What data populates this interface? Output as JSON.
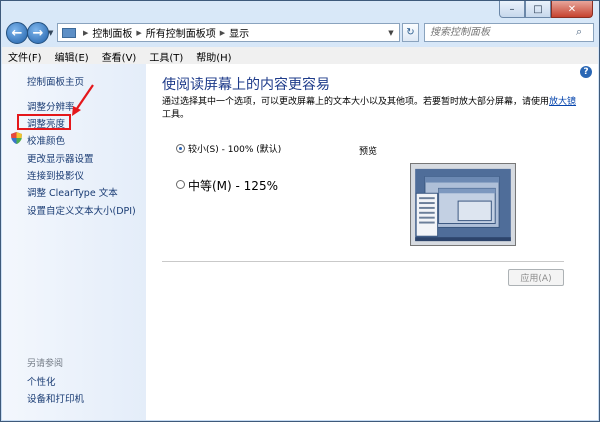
{
  "window": {
    "controls": {
      "minimize": "–",
      "maximize": "□",
      "close": "✕"
    }
  },
  "navigation": {
    "back_icon": "back-arrow-icon",
    "forward_icon": "forward-arrow-icon",
    "breadcrumbs": [
      "控制面板",
      "所有控制面板项",
      "显示"
    ],
    "search_placeholder": "搜索控制面板"
  },
  "menu": [
    "文件(F)",
    "编辑(E)",
    "查看(V)",
    "工具(T)",
    "帮助(H)"
  ],
  "sidebar": {
    "items": [
      "控制面板主页",
      "调整分辨率",
      "调整亮度",
      "校准颜色",
      "更改显示器设置",
      "连接到投影仪",
      "调整 ClearType 文本",
      "设置自定义文本大小(DPI)"
    ],
    "see_also_label": "另请参阅",
    "see_also": [
      "个性化",
      "设备和打印机"
    ]
  },
  "main": {
    "heading": "使阅读屏幕上的内容更容易",
    "desc_text": "通过选择其中一个选项，可以更改屏幕上的文本大小以及其他项。若要暂时放大部分屏幕，请使用",
    "desc_link": "放大镜",
    "desc_tail": "工具。",
    "options": [
      {
        "label": "较小(S) - 100% (默认)",
        "selected": true
      },
      {
        "label": "中等(M) - 125%",
        "selected": false
      }
    ],
    "preview_label": "预览",
    "apply_button": "应用(A)"
  },
  "colors": {
    "accent_link": "#1a3c74",
    "heading": "#1e3b8a",
    "highlight_box": "#e4171b"
  }
}
